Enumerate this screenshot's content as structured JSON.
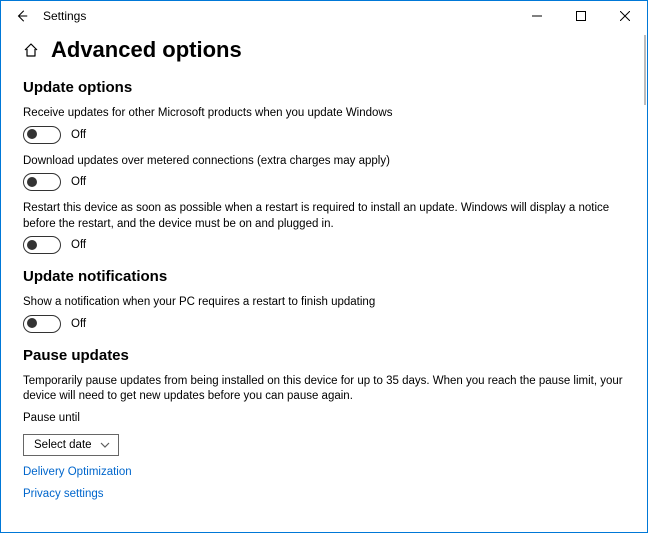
{
  "window": {
    "title": "Settings"
  },
  "page": {
    "heading": "Advanced options"
  },
  "sections": {
    "update_options": {
      "title": "Update options",
      "items": [
        {
          "desc": "Receive updates for other Microsoft products when you update Windows",
          "state": "Off"
        },
        {
          "desc": "Download updates over metered connections (extra charges may apply)",
          "state": "Off"
        },
        {
          "desc": "Restart this device as soon as possible when a restart is required to install an update. Windows will display a notice before the restart, and the device must be on and plugged in.",
          "state": "Off"
        }
      ]
    },
    "update_notifications": {
      "title": "Update notifications",
      "items": [
        {
          "desc": "Show a notification when your PC requires a restart to finish updating",
          "state": "Off"
        }
      ]
    },
    "pause_updates": {
      "title": "Pause updates",
      "desc": "Temporarily pause updates from being installed on this device for up to 35 days. When you reach the pause limit, your device will need to get new updates before you can pause again.",
      "label": "Pause until",
      "select_value": "Select date"
    }
  },
  "links": {
    "delivery": "Delivery Optimization",
    "privacy": "Privacy settings"
  }
}
